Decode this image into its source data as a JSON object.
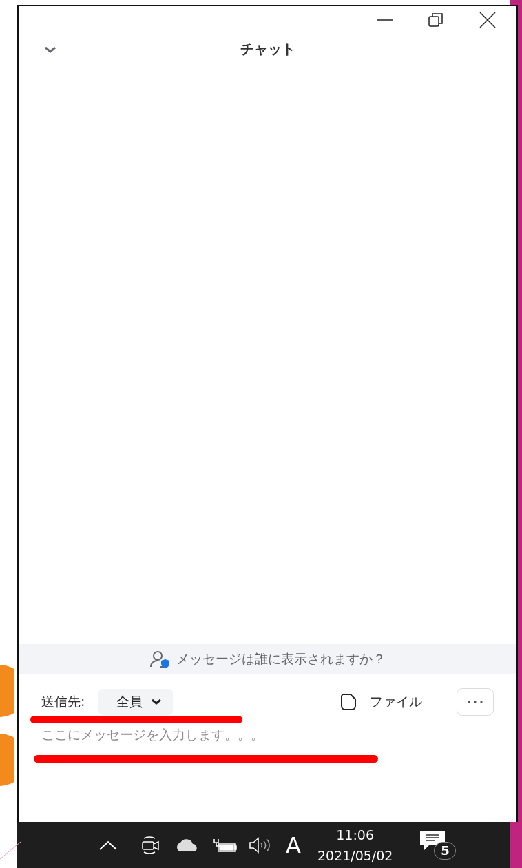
{
  "window": {
    "title": "チャット"
  },
  "privacy_note": "メッセージは誰に表示されますか？",
  "recipient": {
    "label": "送信先:",
    "value": "全員"
  },
  "file_button": "ファイル",
  "message_field": {
    "placeholder": "ここにメッセージを入力します。。。"
  },
  "taskbar": {
    "ime": "A",
    "time": "11:06",
    "date": "2021/05/02",
    "notifications": "5"
  }
}
